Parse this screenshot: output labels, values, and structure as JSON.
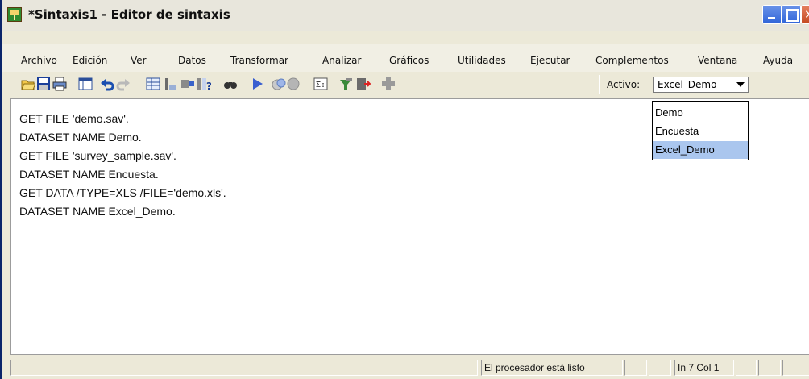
{
  "window": {
    "title": "*Sintaxis1 - Editor de sintaxis",
    "icon": "syntax-editor-icon"
  },
  "menu": [
    {
      "label": "Archivo",
      "name": "menu-archivo"
    },
    {
      "label": "Edición",
      "name": "menu-edicion"
    },
    {
      "label": "Ver",
      "name": "menu-ver"
    },
    {
      "label": "Datos",
      "name": "menu-datos"
    },
    {
      "label": "Transformar",
      "name": "menu-transformar"
    },
    {
      "label": "Analizar",
      "name": "menu-analizar"
    },
    {
      "label": "Gráficos",
      "name": "menu-graficos"
    },
    {
      "label": "Utilidades",
      "name": "menu-utilidades"
    },
    {
      "label": "Ejecutar",
      "name": "menu-ejecutar"
    },
    {
      "label": "Complementos",
      "name": "menu-complementos"
    },
    {
      "label": "Ventana",
      "name": "menu-ventana"
    },
    {
      "label": "Ayuda",
      "name": "menu-ayuda"
    }
  ],
  "toolbar": {
    "icons": [
      "open-folder-icon",
      "save-icon",
      "print-icon",
      "variables-icon",
      "undo-icon",
      "redo-icon",
      "goto-case-icon",
      "goto-variable-icon",
      "data-icon",
      "help-variable-icon",
      "find-icon",
      "run-icon",
      "stop-icon",
      "grid-icon",
      "syntax-help-icon",
      "bookmark-icon",
      "export-icon",
      "add-icon"
    ],
    "active_label": "Activo:",
    "active_dataset": "Excel_Demo"
  },
  "dataset_dropdown": {
    "options": [
      "Demo",
      "Encuesta",
      "Excel_Demo"
    ],
    "selected": "Excel_Demo"
  },
  "editor": {
    "lines": [
      "GET FILE 'demo.sav'.",
      "DATASET NAME Demo.",
      "GET FILE 'survey_sample.sav'.",
      "DATASET NAME Encuesta.",
      "GET DATA /TYPE=XLS /FILE='demo.xls'.",
      "DATASET NAME Excel_Demo."
    ]
  },
  "status": {
    "processor": "El procesador está listo",
    "position": "In 7 Col 1"
  },
  "colors": {
    "window_border": "#0a246a",
    "selection": "#aac6ee",
    "toolbar_bg": "#ece9d8"
  }
}
